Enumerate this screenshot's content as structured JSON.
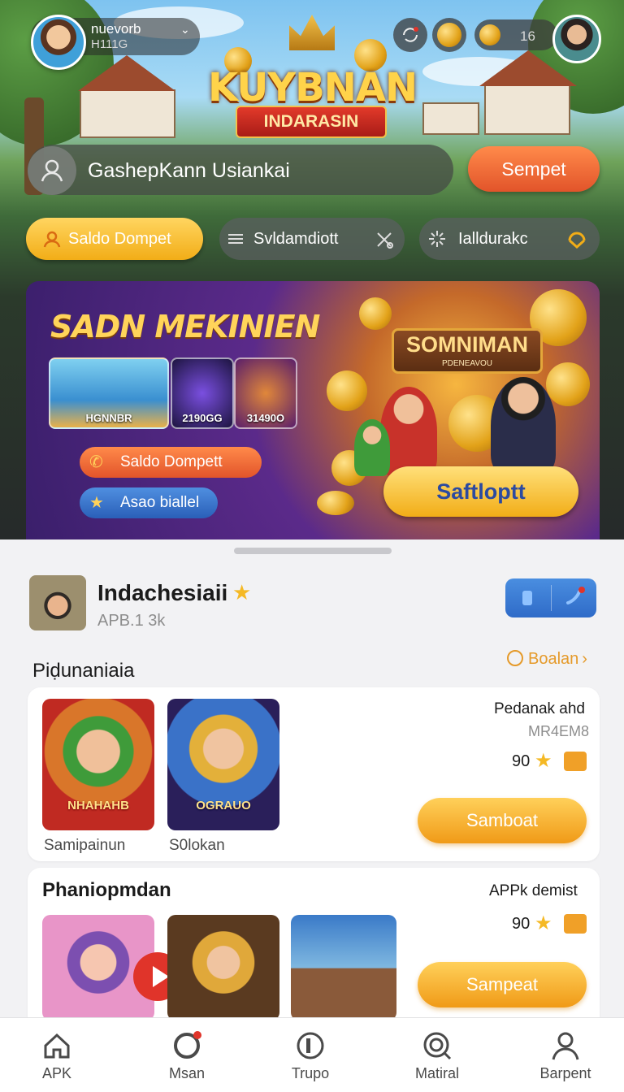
{
  "header": {
    "user_name": "nuevorb",
    "user_id": "H111G",
    "coins": "16",
    "logo_title": "KUYBNAN",
    "logo_ribbon": "INDARASIN"
  },
  "search": {
    "text": "GashepKann Usiankai",
    "button_label": "Sempet"
  },
  "filters": [
    {
      "label": "Saldo Dompet"
    },
    {
      "label": "Svldamdiott"
    },
    {
      "label": "Ialldurakc"
    }
  ],
  "banner": {
    "title": "SADN MEKINIEN",
    "thumb_labels": [
      "HGNNBR",
      "2190GG",
      "31490O"
    ],
    "button1_label": "Saldo Dompett",
    "button2_label": "Asao biallel",
    "sign_title": "SOMNIMAN",
    "sign_sub": "PDENEAVOU",
    "cta_label": "Saftloptt"
  },
  "game": {
    "title": "Indachesiaii",
    "subtitle": "APB.1 3k"
  },
  "section": {
    "title": "Piḍunaniaia",
    "see_all": "Boalan"
  },
  "card1": {
    "thumb_labels": [
      "Samipainun",
      "S0lokan"
    ],
    "thumb_art": [
      "NHAHAHB",
      "OGRAUO"
    ],
    "caption_title": "Pedanak ahd",
    "caption_sub": "MR4EM8",
    "price": "90",
    "button_label": "Samboat"
  },
  "card2": {
    "title": "Phaniopmdan",
    "caption_title": "APPk demist",
    "price": "90",
    "button_label": "Sampeat"
  },
  "nav": [
    {
      "label": "APK"
    },
    {
      "label": "Msan"
    },
    {
      "label": "Trupo"
    },
    {
      "label": "Matiral"
    },
    {
      "label": "Barpent"
    }
  ],
  "colors": {
    "accent_orange": "#f09a17",
    "accent_red": "#e2542a",
    "share_blue": "#2f6bc8"
  }
}
